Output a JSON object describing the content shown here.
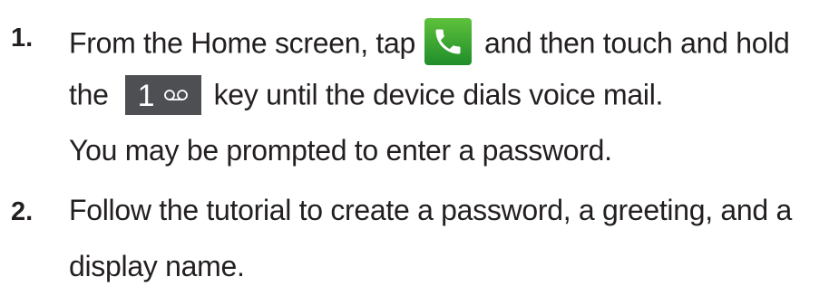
{
  "steps": [
    {
      "number": "1.",
      "line1_part1": "From the Home screen, tap",
      "line1_part2": "and then touch and hold",
      "line2_part1": "the",
      "key_digit": "1",
      "line2_part2": "key until the device dials voice mail.",
      "line3": "You may be prompted to enter a password."
    },
    {
      "number": "2.",
      "line1": "Follow the tutorial to create a password, a greeting, and a",
      "line2": "display name."
    }
  ],
  "icons": {
    "phone": "phone-icon",
    "voicemail": "voicemail-icon",
    "phone_bg": "#3aa83a",
    "key_bg": "#4d4f53"
  }
}
